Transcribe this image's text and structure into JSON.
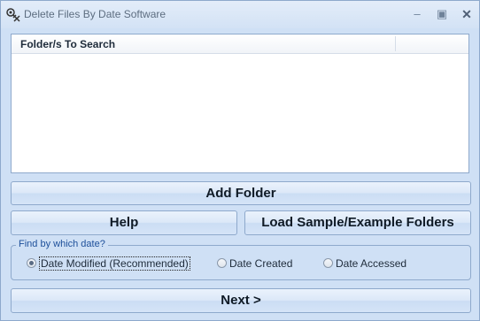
{
  "window": {
    "title": "Delete Files By Date Software"
  },
  "listview": {
    "columns": [
      "Folder/s To Search"
    ],
    "rows": []
  },
  "buttons": {
    "add_folder": "Add Folder",
    "help": "Help",
    "load_sample": "Load Sample/Example Folders",
    "next": "Next >"
  },
  "date_group": {
    "legend": "Find by which date?",
    "options": [
      {
        "label": "Date Modified (Recommended)",
        "selected": true
      },
      {
        "label": "Date Created",
        "selected": false
      },
      {
        "label": "Date Accessed",
        "selected": false
      }
    ]
  },
  "colors": {
    "window_bg": "#cfe0f5",
    "border": "#8ea9cc",
    "legend": "#1d4f9a"
  }
}
